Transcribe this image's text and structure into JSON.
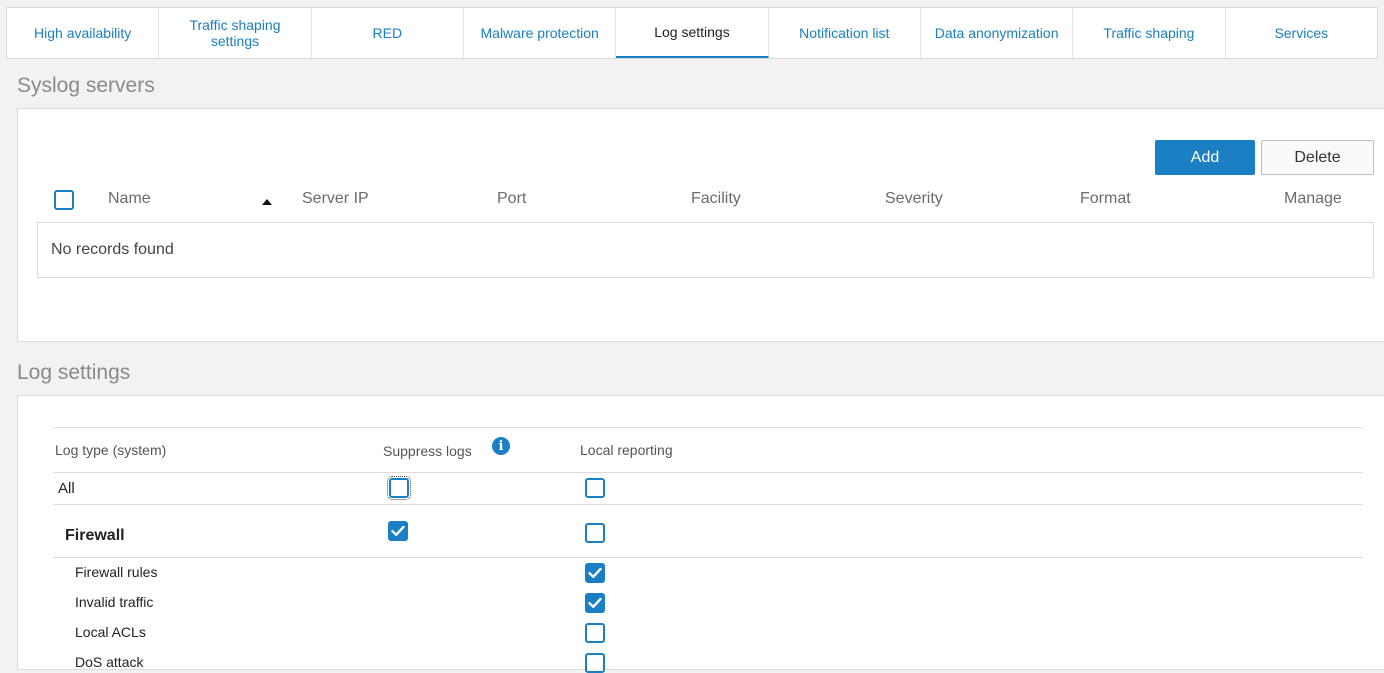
{
  "tabs": [
    {
      "label": "High availability",
      "active": false
    },
    {
      "label": "Traffic shaping settings",
      "active": false
    },
    {
      "label": "RED",
      "active": false
    },
    {
      "label": "Malware protection",
      "active": false
    },
    {
      "label": "Log settings",
      "active": true
    },
    {
      "label": "Notification list",
      "active": false
    },
    {
      "label": "Data anonymization",
      "active": false
    },
    {
      "label": "Traffic shaping",
      "active": false
    },
    {
      "label": "Services",
      "active": false
    }
  ],
  "syslog": {
    "title": "Syslog servers",
    "add_label": "Add",
    "delete_label": "Delete",
    "columns": [
      "Name",
      "Server IP",
      "Port",
      "Facility",
      "Severity",
      "Format",
      "Manage"
    ],
    "empty_text": "No records found"
  },
  "log_settings": {
    "title": "Log settings",
    "headers": {
      "log_type": "Log type (system)",
      "suppress": "Suppress logs",
      "local_reporting": "Local reporting"
    },
    "all_label": "All",
    "rows": [
      {
        "label": "Firewall",
        "group": true,
        "suppress": true,
        "local": false
      },
      {
        "label": "Firewall rules",
        "group": false,
        "local": true
      },
      {
        "label": "Invalid traffic",
        "group": false,
        "local": true
      },
      {
        "label": "Local ACLs",
        "group": false,
        "local": false
      },
      {
        "label": "DoS attack",
        "group": false,
        "local": false
      }
    ]
  },
  "colors": {
    "accent": "#1b7fc4",
    "link": "#1a7fc1"
  },
  "icons": {
    "info": "info-icon",
    "check": "check-icon",
    "sort": "sort-ascending-icon"
  }
}
